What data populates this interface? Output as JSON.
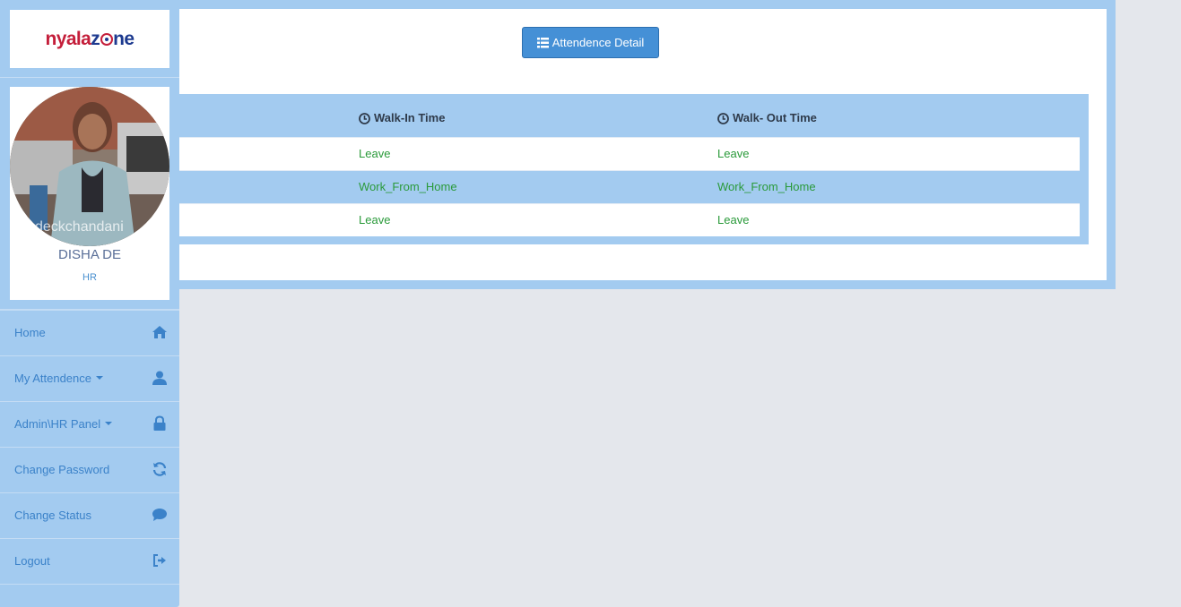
{
  "brand": {
    "logo_part1": "nyala",
    "logo_part2": "z",
    "logo_part3": "ne"
  },
  "profile": {
    "name": "DISHA DE",
    "role": "HR",
    "watermark": "deckchandani"
  },
  "sidebar": {
    "items": [
      {
        "label": "Home",
        "icon": "home-icon",
        "has_caret": false
      },
      {
        "label": "My Attendence",
        "icon": "user-icon",
        "has_caret": true
      },
      {
        "label": "Admin\\HR Panel",
        "icon": "lock-icon",
        "has_caret": true
      },
      {
        "label": "Change Password",
        "icon": "refresh-icon",
        "has_caret": false
      },
      {
        "label": "Change Status",
        "icon": "comment-icon",
        "has_caret": false
      },
      {
        "label": "Logout",
        "icon": "logout-icon",
        "has_caret": false
      }
    ]
  },
  "main": {
    "detail_button": "Attendence Detail",
    "table": {
      "headers": [
        "Walk-In Time",
        "Walk- Out Time"
      ],
      "rows": [
        [
          "Leave",
          "Leave"
        ],
        [
          "Work_From_Home",
          "Work_From_Home"
        ],
        [
          "Leave",
          "Leave"
        ]
      ]
    }
  },
  "colors": {
    "sidebar_bg": "#a3cbf0",
    "page_bg": "#e4e7ec",
    "accent": "#4590d6",
    "status_text": "#2a9a3a"
  }
}
